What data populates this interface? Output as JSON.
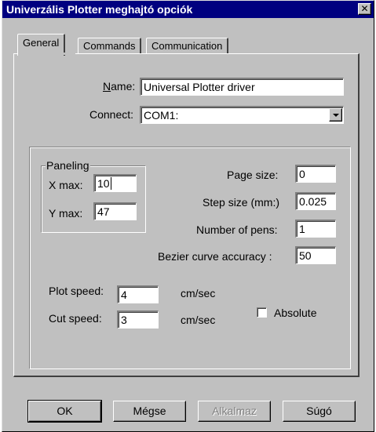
{
  "window": {
    "title": "Univerzális Plotter meghajtó opciók",
    "close_glyph": "✕"
  },
  "tabs": [
    {
      "label": "General",
      "active": true
    },
    {
      "label": "Commands",
      "active": false
    },
    {
      "label": "Communication",
      "active": false
    }
  ],
  "general": {
    "name_label_underlined": "N",
    "name_label_rest": "ame:",
    "name_value": "Universal Plotter driver",
    "connect_label": "Connect:",
    "connect_value": "COM1:",
    "paneling": {
      "title": "Paneling",
      "xmax_label": "X max:",
      "xmax_value": "10",
      "ymax_label": "Y max:",
      "ymax_value": "47"
    },
    "page_size_label": "Page size:",
    "page_size_value": "0",
    "step_size_label": "Step size (mm:)",
    "step_size_value": "0.025",
    "pens_label": "Number of pens:",
    "pens_value": "1",
    "bezier_label": "Bezier curve accuracy :",
    "bezier_value": "50",
    "plot_speed_label": "Plot speed:",
    "plot_speed_value": "4",
    "plot_speed_unit": "cm/sec",
    "cut_speed_label": "Cut speed:",
    "cut_speed_value": "3",
    "cut_speed_unit": "cm/sec",
    "absolute_label": "Absolute",
    "absolute_checked": false
  },
  "buttons": {
    "ok": "OK",
    "cancel": "Mégse",
    "apply": "Alkalmaz",
    "help": "Súgó"
  },
  "colors": {
    "titlebar": "#000080",
    "face": "#c0c0c0",
    "disabled_text": "#808080"
  }
}
